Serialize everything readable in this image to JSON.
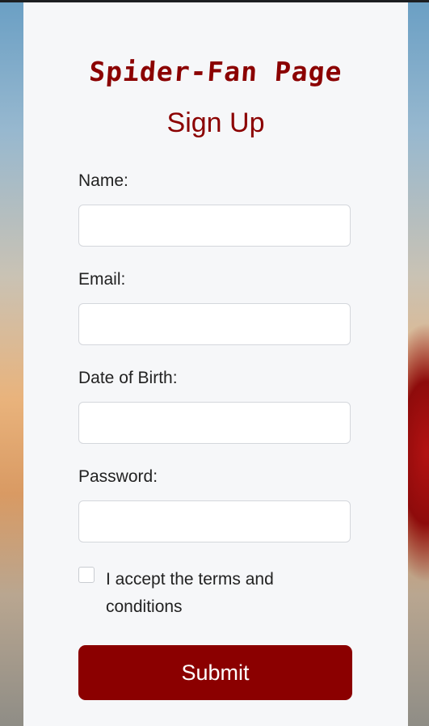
{
  "site": {
    "brand": "Spider-Fan Page"
  },
  "form": {
    "heading": "Sign Up",
    "name_label": "Name:",
    "name_value": "",
    "email_label": "Email:",
    "email_value": "",
    "dob_label": "Date of Birth:",
    "dob_value": "",
    "password_label": "Password:",
    "password_value": "",
    "terms_label": "I accept the terms and conditions",
    "terms_checked": false,
    "submit_label": "Submit"
  },
  "colors": {
    "accent": "#8b0000",
    "card_bg": "#f6f7f9"
  }
}
